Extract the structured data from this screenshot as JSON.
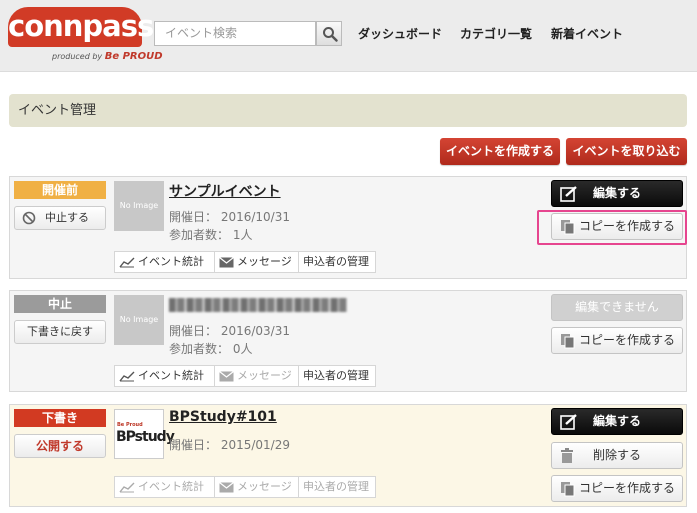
{
  "header": {
    "logo_text": "connpass",
    "logo_sub": "produced by",
    "logo_brand": "Be PROUD",
    "search_placeholder": "イベント検索",
    "nav": [
      "ダッシュボード",
      "カテゴリ一覧",
      "新着イベント"
    ]
  },
  "page": {
    "title": "イベント管理",
    "create_button": "イベントを作成する",
    "import_button": "イベントを取り込む"
  },
  "tabs": {
    "stats": "イベント統計",
    "message": "メッセージ",
    "applicants": "申込者の管理"
  },
  "events": [
    {
      "status": "開催前",
      "status_color": "#f0b044",
      "status_action": "中止する",
      "thumb": "No Image",
      "title": "サンプルイベント",
      "date": "開催日： 2016/10/31",
      "participants": "参加者数： 1人",
      "primary_action": "編集する",
      "secondary_action": "コピーを作成する"
    },
    {
      "status": "中止",
      "status_color": "#9b9b9b",
      "status_action": "下書きに戻す",
      "thumb": "No Image",
      "date": "開催日： 2016/03/31",
      "participants": "参加者数： 0人",
      "primary_action": "編集できません",
      "secondary_action": "コピーを作成する"
    },
    {
      "status": "下書き",
      "status_color": "#d23a22",
      "status_action": "公開する",
      "thumb_pre": "Be Proud",
      "thumb_text": "BPstudy",
      "title": "BPStudy#101",
      "date": "開催日： 2015/01/29",
      "primary_action": "編集する",
      "delete_action": "削除する",
      "secondary_action": "コピーを作成する"
    }
  ]
}
